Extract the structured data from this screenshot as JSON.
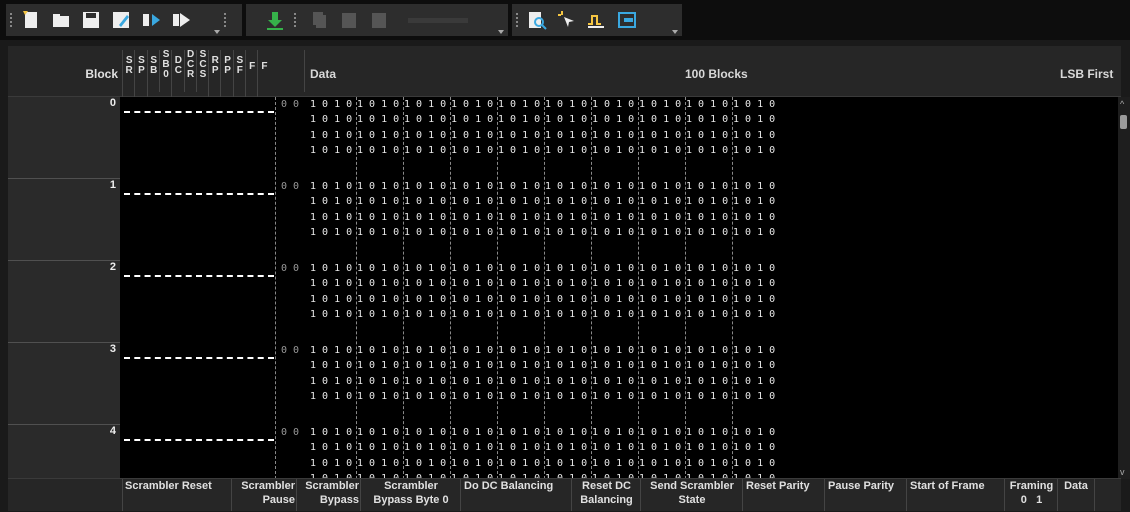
{
  "toolbar": {
    "icons": [
      "new-file-icon",
      "open-folder-icon",
      "save-icon",
      "save-as-icon",
      "import-icon",
      "export-icon",
      "download-icon",
      "copy-icon",
      "paste-icon",
      "paste-special-icon",
      "zoom-icon",
      "select-pointer-icon",
      "pulse-icon",
      "exit-panel-icon"
    ]
  },
  "header": {
    "block": "Block",
    "flags": [
      [
        "S",
        "R"
      ],
      [
        "S",
        "P"
      ],
      [
        "S",
        "B"
      ],
      [
        "S",
        "B",
        "0"
      ],
      [
        "D",
        "C"
      ],
      [
        "D",
        "C",
        "R"
      ],
      [
        "S",
        "C",
        "S"
      ],
      [
        "R",
        "P"
      ],
      [
        "P",
        "P"
      ],
      [
        "S",
        "F"
      ],
      [
        "F"
      ],
      [
        "F"
      ]
    ],
    "data": "Data",
    "center": "100 Blocks",
    "order": "LSB First"
  },
  "blocks": [
    "0",
    "1",
    "2",
    "3",
    "4"
  ],
  "framing_prefix": "0 0",
  "bit_pattern": "1 0 1 0",
  "footer": {
    "scrambler_reset": "Scrambler Reset",
    "scrambler_pause": "Scrambler Pause",
    "scrambler_bypass": "Scrambler Bypass",
    "scrambler_bypass_byte0": "Scrambler Bypass Byte 0",
    "do_dc": "Do DC Balancing",
    "reset_dc": "Reset DC Balancing",
    "send_scrambler": "Send Scrambler State",
    "reset_parity": "Reset Parity",
    "pause_parity": "Pause Parity",
    "start_frame": "Start of Frame",
    "framing": "Framing",
    "framing_bits": "0   1",
    "data": "Data"
  }
}
